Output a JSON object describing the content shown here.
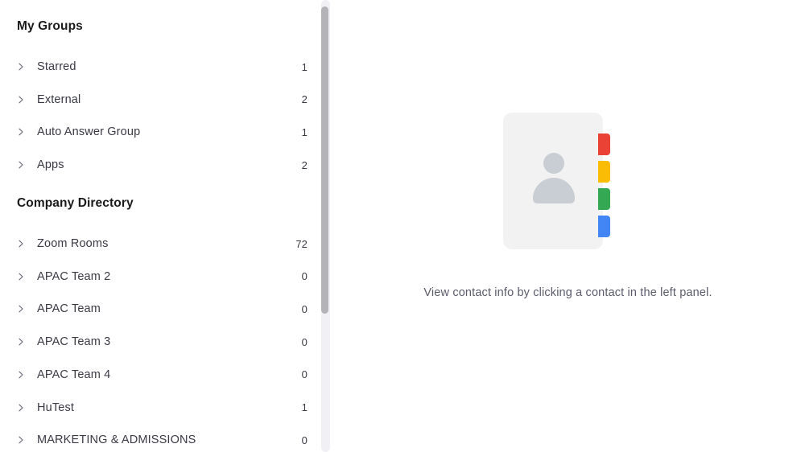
{
  "sidebar": {
    "scrollbar": {
      "thumb_label": "vertical-scrollbar-thumb"
    },
    "sections": [
      {
        "title": "My Groups",
        "items": [
          {
            "label": "Starred",
            "count": "1",
            "icon": "chevron-right-icon"
          },
          {
            "label": "External",
            "count": "2",
            "icon": "chevron-right-icon"
          },
          {
            "label": "Auto Answer Group",
            "count": "1",
            "icon": "chevron-right-icon"
          },
          {
            "label": "Apps",
            "count": "2",
            "icon": "chevron-right-icon"
          }
        ]
      },
      {
        "title": "Company Directory",
        "items": [
          {
            "label": "Zoom Rooms",
            "count": "72",
            "icon": "chevron-right-icon"
          },
          {
            "label": "APAC Team 2",
            "count": "0",
            "icon": "chevron-right-icon"
          },
          {
            "label": "APAC Team",
            "count": "0",
            "icon": "chevron-right-icon"
          },
          {
            "label": "APAC Team 3",
            "count": "0",
            "icon": "chevron-right-icon"
          },
          {
            "label": "APAC Team 4",
            "count": "0",
            "icon": "chevron-right-icon"
          },
          {
            "label": "HuTest",
            "count": "1",
            "icon": "chevron-right-icon"
          },
          {
            "label": "MARKETING & ADMISSIONS",
            "count": "0",
            "icon": "chevron-right-icon"
          }
        ]
      }
    ]
  },
  "detail_panel": {
    "empty_state": {
      "illustration": "contact-card-icon",
      "message": "View contact info by clicking a contact in the left panel.",
      "card_tab_colors": [
        "#ea4335",
        "#fbbc05",
        "#34a853",
        "#4285f4"
      ],
      "card_background": "#f2f2f2",
      "person_color": "#c9ced4"
    }
  },
  "colors": {
    "text_primary": "#1a1a1a",
    "text_secondary": "#3a3a45",
    "text_muted": "#5b5b6b",
    "scrollbar_thumb": "#b3b3b8",
    "scrollbar_track": "#f0f0f5",
    "panel_background": "#ffffff"
  }
}
